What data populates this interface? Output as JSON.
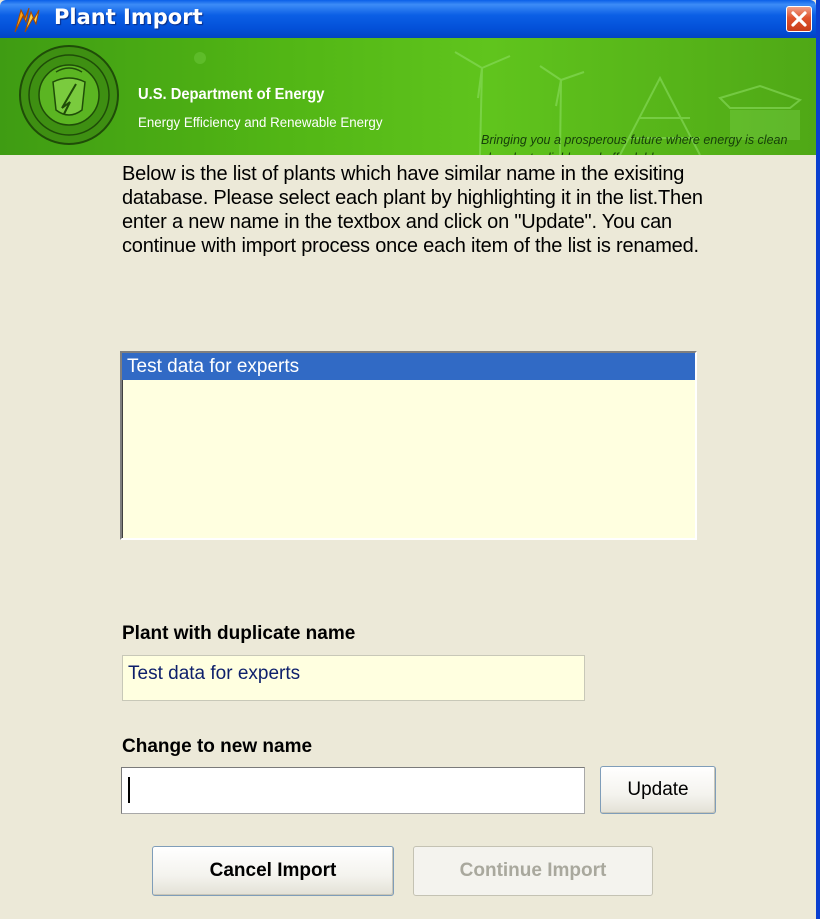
{
  "window": {
    "title": "Plant Import",
    "close_icon": "close-x-icon",
    "app_icon": "flame-icon"
  },
  "banner": {
    "org": "U.S. Department of Energy",
    "subtitle": "Energy Efficiency and Renewable Energy",
    "tagline": "Bringing you a prosperous future where energy is clean abundant reliable and affordable",
    "seal_icon": "doe-seal-icon",
    "colors": {
      "green": "#52b615",
      "tagline": "#17400a"
    }
  },
  "instructions": "Below is the list of plants which have similar name in the exisiting database. Please select each plant by highlighting it in the list.Then enter a new name in the textbox and click on \"Update\". You can continue with import process once each item of the list is renamed.",
  "plant_list": {
    "items": [
      "Test data for experts"
    ],
    "selected_index": 0
  },
  "duplicate": {
    "label": "Plant with duplicate name",
    "value": "Test data for experts"
  },
  "rename": {
    "label": "Change to new name",
    "value": "",
    "update_label": "Update"
  },
  "buttons": {
    "cancel": "Cancel Import",
    "continue": "Continue Import",
    "continue_enabled": false
  },
  "colors": {
    "titlebar": "#0350d8",
    "selection": "#316ac5",
    "field_bg": "#ffffe0",
    "window_bg": "#ece9d8"
  }
}
